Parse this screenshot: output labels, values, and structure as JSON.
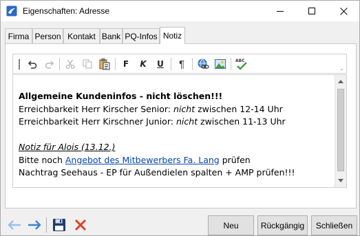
{
  "window": {
    "title": "Eigenschaften: Adresse",
    "accent": "#2a6ac8"
  },
  "tabs": [
    {
      "label": "Firma"
    },
    {
      "label": "Person"
    },
    {
      "label": "Kontakt"
    },
    {
      "label": "Bank"
    },
    {
      "label": "PQ-Infos"
    },
    {
      "label": "Notiz",
      "active": true
    }
  ],
  "toolbar": {
    "bold_label": "F",
    "italic_label": "K",
    "underline_label": "U",
    "pilcrow_label": "¶",
    "spell_label": "ABC"
  },
  "editor": {
    "line1": "Allgemeine Kundeninfos - nicht löschen!!!",
    "line2_pre": "Erreichbarkeit Herr Kirscher Senior: ",
    "line2_em": "nicht",
    "line2_post": " zwischen 12-14 Uhr",
    "line3_pre": "Erreichbarkeit Herr Kirschner Junior: ",
    "line3_em": "nicht",
    "line3_post": " zwischen 11-13 Uhr",
    "line4": "Notiz für Alois (13.12.)",
    "line5_pre": "Bitte noch ",
    "line5_link": "Angebot des Mitbewerbers Fa. Lang",
    "line5_post": " prüfen",
    "line6": "Nachtrag Seehaus - EP für Außendielen spalten + AMP prüfen!!!"
  },
  "footer": {
    "new_label": "Neu",
    "undo_label": "Rückgängig",
    "close_label": "Schließen"
  },
  "colors": {
    "nav_arrow": "#4a8ad8",
    "save_icon": "#1f3c6e",
    "delete_icon": "#e04020",
    "link": "#0645ad"
  }
}
